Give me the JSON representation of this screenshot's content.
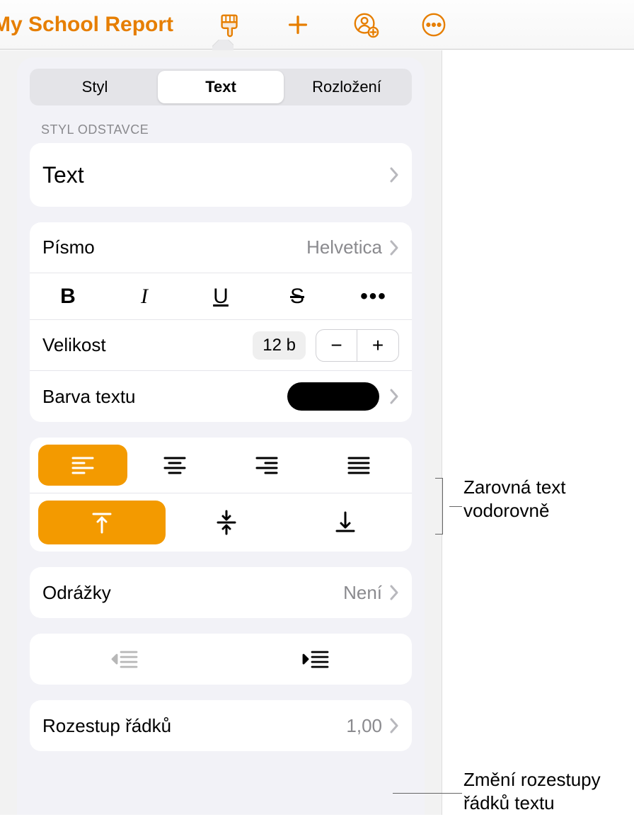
{
  "toolbar": {
    "title": "My School Report"
  },
  "tabs": {
    "style": "Styl",
    "text": "Text",
    "layout": "Rozložení"
  },
  "paragraph": {
    "header": "Styl odstavce",
    "style_name": "Text"
  },
  "font": {
    "label": "Písmo",
    "value": "Helvetica",
    "bold": "B",
    "italic": "I",
    "underline": "U",
    "strike": "S",
    "more": "•••",
    "size_label": "Velikost",
    "size_value": "12 b",
    "color_label": "Barva textu"
  },
  "bullets": {
    "label": "Odrážky",
    "value": "Není"
  },
  "spacing": {
    "label": "Rozestup řádků",
    "value": "1,00"
  },
  "callouts": {
    "align": "Zarovná text vodorovně",
    "spacing": "Změní rozestupy řádků textu"
  }
}
